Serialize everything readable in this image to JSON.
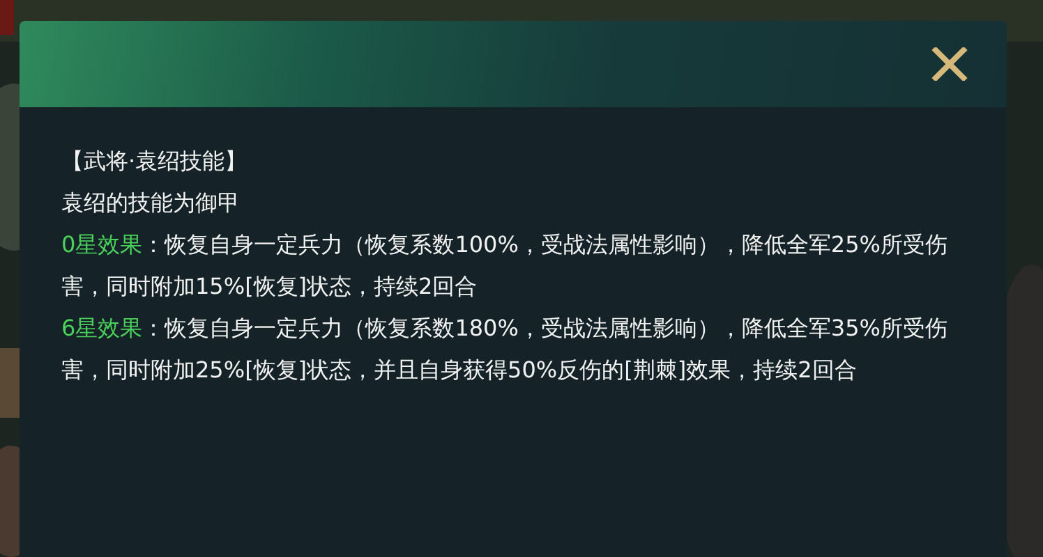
{
  "dialog": {
    "heading": "【武将·袁绍技能】",
    "subtitle": "袁绍的技能为御甲",
    "effects": [
      {
        "label": "0星效果",
        "text": "：恢复自身一定兵力（恢复系数100%，受战法属性影响），降低全军25%所受伤害，同时附加15%[恢复]状态，持续2回合"
      },
      {
        "label": "6星效果",
        "text": "：恢复自身一定兵力（恢复系数180%，受战法属性影响），降低全军35%所受伤害，同时附加25%[恢复]状态，并且自身获得50%反伤的[荆棘]效果，持续2回合"
      }
    ]
  }
}
